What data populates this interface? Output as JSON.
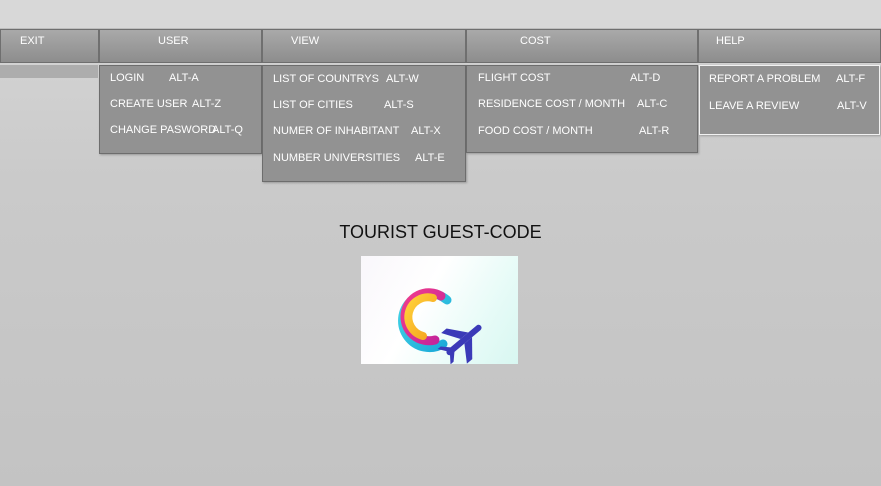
{
  "menubar": {
    "exit": "EXIT",
    "user": "USER",
    "view": "VIEW",
    "cost": "COST",
    "help": "HELP"
  },
  "user_menu": [
    {
      "label": "LOGIN",
      "shortcut": "ALT-A"
    },
    {
      "label": "CREATE USER",
      "shortcut": "ALT-Z"
    },
    {
      "label": "CHANGE PASWORD",
      "shortcut": "ALT-Q"
    }
  ],
  "view_menu": [
    {
      "label": "LIST OF COUNTRYS",
      "shortcut": "ALT-W"
    },
    {
      "label": "LIST OF CITIES",
      "shortcut": "ALT-S"
    },
    {
      "label": "NUMER OF INHABITANT",
      "shortcut": "ALT-X"
    },
    {
      "label": "NUMBER UNIVERSITIES",
      "shortcut": "ALT-E"
    }
  ],
  "cost_menu": [
    {
      "label": "FLIGHT COST",
      "shortcut": "ALT-D"
    },
    {
      "label": "RESIDENCE COST / MONTH",
      "shortcut": "ALT-C"
    },
    {
      "label": "FOOD COST / MONTH",
      "shortcut": "ALT-R"
    }
  ],
  "help_menu": [
    {
      "label": "REPORT A PROBLEM",
      "shortcut": "ALT-F"
    },
    {
      "label": "LEAVE A REVIEW",
      "shortcut": "ALT-V"
    }
  ],
  "main": {
    "title": "TOURIST GUEST-CODE",
    "logo_icon": "swirl-airplane-logo-icon"
  },
  "colors": {
    "menu_bg": "#929292",
    "background": "#c8c8c8",
    "logo_plane": "#3b3ab8"
  }
}
